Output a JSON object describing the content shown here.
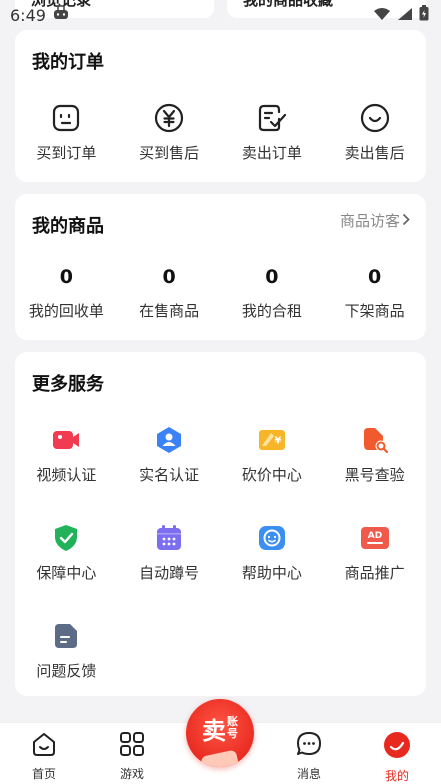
{
  "status_bar": {
    "time": "6:49"
  },
  "top_cards": {
    "left_label": "浏览记录",
    "right_label": "我的商品收藏"
  },
  "orders": {
    "title": "我的订单",
    "items": [
      {
        "label": "买到订单",
        "icon": "buy-order-icon"
      },
      {
        "label": "买到售后",
        "icon": "yen-icon"
      },
      {
        "label": "卖出订单",
        "icon": "sell-order-icon"
      },
      {
        "label": "卖出售后",
        "icon": "smile-icon"
      }
    ]
  },
  "goods": {
    "title": "我的商品",
    "link": "商品访客",
    "items": [
      {
        "count": "0",
        "label": "我的回收单"
      },
      {
        "count": "0",
        "label": "在售商品"
      },
      {
        "count": "0",
        "label": "我的合租"
      },
      {
        "count": "0",
        "label": "下架商品"
      }
    ]
  },
  "services": {
    "title": "更多服务",
    "items": [
      {
        "label": "视频认证",
        "icon": "video-icon",
        "color": "#f03b50"
      },
      {
        "label": "实名认证",
        "icon": "user-badge-icon",
        "color": "#3b82f6"
      },
      {
        "label": "砍价中心",
        "icon": "bargain-icon",
        "color": "#f7b52a"
      },
      {
        "label": "黑号查验",
        "icon": "blacklist-check-icon",
        "color": "#f05a2e"
      },
      {
        "label": "保障中心",
        "icon": "shield-icon",
        "color": "#22b35a"
      },
      {
        "label": "自动蹲号",
        "icon": "calendar-icon",
        "color": "#7b6ff0"
      },
      {
        "label": "帮助中心",
        "icon": "help-face-icon",
        "color": "#3b8ff0"
      },
      {
        "label": "商品推广",
        "icon": "ad-icon",
        "color": "#f05a4a"
      },
      {
        "label": "问题反馈",
        "icon": "feedback-icon",
        "color": "#5c6b86"
      }
    ]
  },
  "tabbar": {
    "items": [
      {
        "label": "首页",
        "icon": "home-icon"
      },
      {
        "label": "游戏",
        "icon": "grid-icon"
      },
      {
        "label": "消息",
        "icon": "message-icon"
      },
      {
        "label": "我的",
        "icon": "profile-icon"
      }
    ],
    "sell": {
      "big": "卖",
      "small_top": "账",
      "small_bottom": "号"
    },
    "active_color": "#e8291f"
  }
}
